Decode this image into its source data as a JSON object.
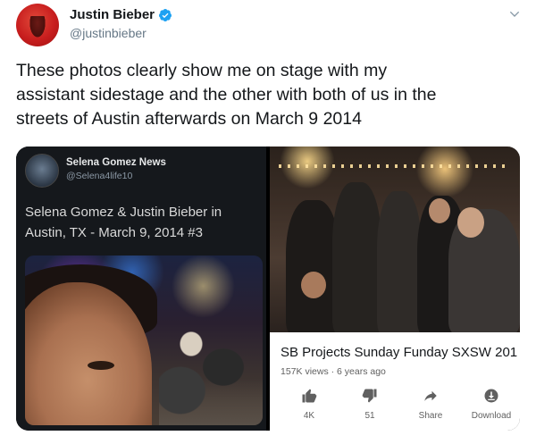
{
  "author": {
    "display_name": "Justin Bieber",
    "handle": "@justinbieber",
    "verified": true
  },
  "tweet": {
    "text_lines": [
      "These photos clearly show me on stage with my",
      "assistant sidestage and the other with both of us in the",
      "streets of Austin afterwards on March 9 2014"
    ]
  },
  "embedded_left": {
    "account_name": "Selena Gomez News",
    "account_handle": "@Selena4life10",
    "text_lines": [
      "Selena Gomez & Justin Bieber in",
      "Austin, TX - March 9, 2014 #3"
    ]
  },
  "embedded_right": {
    "video_title": "SB Projects Sunday Funday SXSW 201",
    "meta": "157K views · 6 years ago",
    "actions": [
      {
        "icon": "thumbs-up-icon",
        "label": "4K"
      },
      {
        "icon": "thumbs-down-icon",
        "label": "51"
      },
      {
        "icon": "share-icon",
        "label": "Share"
      },
      {
        "icon": "download-icon",
        "label": "Download"
      }
    ]
  },
  "colors": {
    "verified_blue": "#1da1f2",
    "text_primary": "#14171a",
    "text_secondary": "#657786"
  }
}
